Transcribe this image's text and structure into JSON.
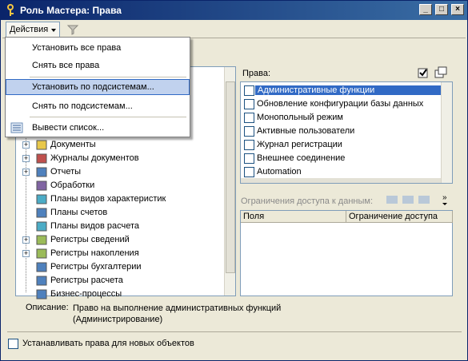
{
  "window": {
    "title": "Роль Мастера: Права"
  },
  "toolbar": {
    "actions_label": "Действия"
  },
  "menu": {
    "items": [
      {
        "label": "Установить все права"
      },
      {
        "label": "Снять все права"
      },
      {
        "label": "Установить по подсистемам..."
      },
      {
        "label": "Снять по подсистемам..."
      },
      {
        "label": "Вывести список..."
      }
    ]
  },
  "tree": {
    "items": [
      {
        "label": "Документы",
        "icon": "folder-icon",
        "expandable": true
      },
      {
        "label": "Журналы документов",
        "icon": "journal-icon",
        "expandable": true
      },
      {
        "label": "Отчеты",
        "icon": "report-icon",
        "expandable": true
      },
      {
        "label": "Обработки",
        "icon": "processing-icon",
        "expandable": false
      },
      {
        "label": "Планы видов характеристик",
        "icon": "chart-of-characteristics-icon",
        "expandable": false
      },
      {
        "label": "Планы счетов",
        "icon": "chart-of-accounts-icon",
        "expandable": false
      },
      {
        "label": "Планы видов расчета",
        "icon": "chart-of-calculation-icon",
        "expandable": false
      },
      {
        "label": "Регистры сведений",
        "icon": "info-register-icon",
        "expandable": true
      },
      {
        "label": "Регистры накопления",
        "icon": "accumulation-register-icon",
        "expandable": true
      },
      {
        "label": "Регистры бухгалтерии",
        "icon": "accounting-register-icon",
        "expandable": false
      },
      {
        "label": "Регистры расчета",
        "icon": "calculation-register-icon",
        "expandable": false
      },
      {
        "label": "Бизнес-процессы",
        "icon": "business-process-icon",
        "expandable": false
      }
    ]
  },
  "rights": {
    "label": "Права:",
    "items": [
      {
        "label": "Административные функции",
        "selected": true
      },
      {
        "label": "Обновление конфигурации базы данных",
        "selected": false
      },
      {
        "label": "Монопольный режим",
        "selected": false
      },
      {
        "label": "Активные пользователи",
        "selected": false
      },
      {
        "label": "Журнал регистрации",
        "selected": false
      },
      {
        "label": "Внешнее соединение",
        "selected": false
      },
      {
        "label": "Automation",
        "selected": false
      }
    ]
  },
  "restrictions": {
    "label": "Ограничения доступа к данным:",
    "columns": [
      "Поля",
      "Ограничение доступа"
    ]
  },
  "description": {
    "label": "Описание:",
    "text": "Право на выполнение административных функций (Администрирование)"
  },
  "new_objects": {
    "label": "Устанавливать права для новых объектов"
  },
  "colors": {
    "selection": "#316ac5",
    "menu_highlight": "#c1d2ee",
    "titlebar": "#0a246a"
  }
}
